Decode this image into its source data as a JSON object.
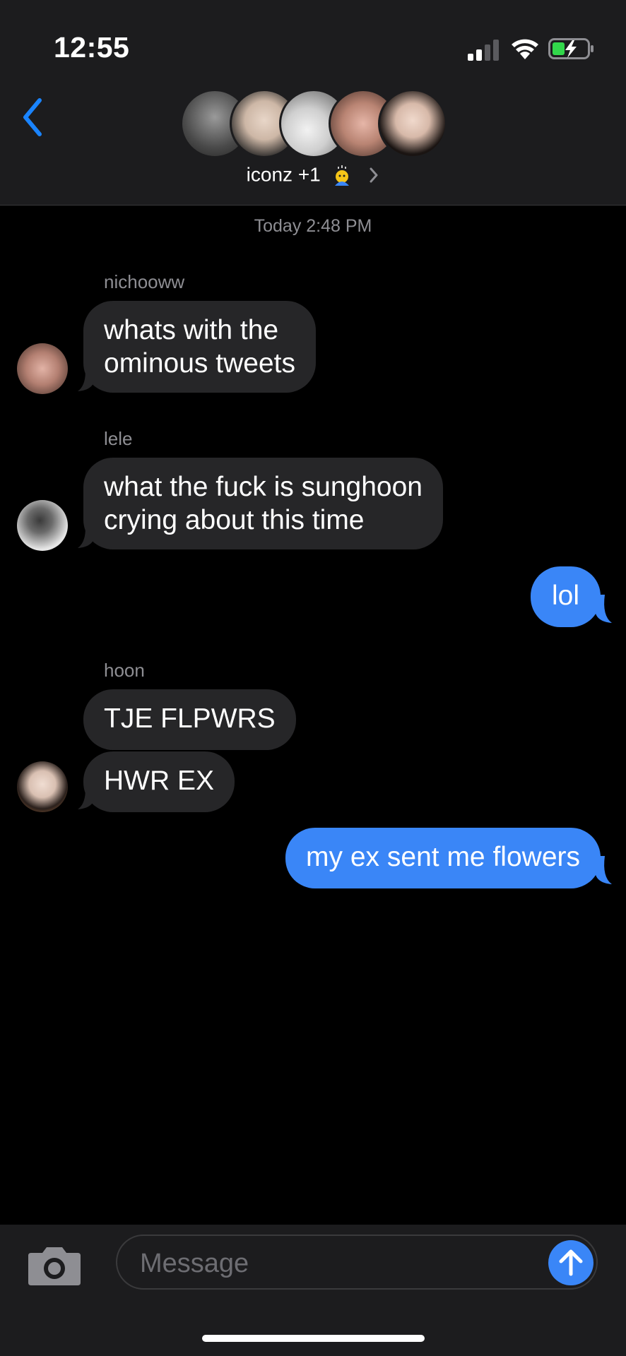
{
  "status_bar": {
    "time": "12:55"
  },
  "header": {
    "group_title": "iconz +1"
  },
  "timestamp": "Today 2:48 PM",
  "messages": [
    {
      "sender": "nichooww",
      "lines": [
        "whats with the",
        "ominous tweets"
      ]
    },
    {
      "sender": "lele",
      "lines": [
        "what the fuck is sunghoon",
        "crying about this time"
      ]
    },
    {
      "text": "lol"
    },
    {
      "sender": "hoon",
      "text1": "TJE FLPWRS",
      "text2": "HWR EX"
    },
    {
      "text": "my ex sent me flowers"
    }
  ],
  "composer": {
    "placeholder": "Message"
  },
  "colors": {
    "sent_bubble": "#3a86f7",
    "received_bubble": "#262628",
    "accent": "#1a84ff"
  }
}
